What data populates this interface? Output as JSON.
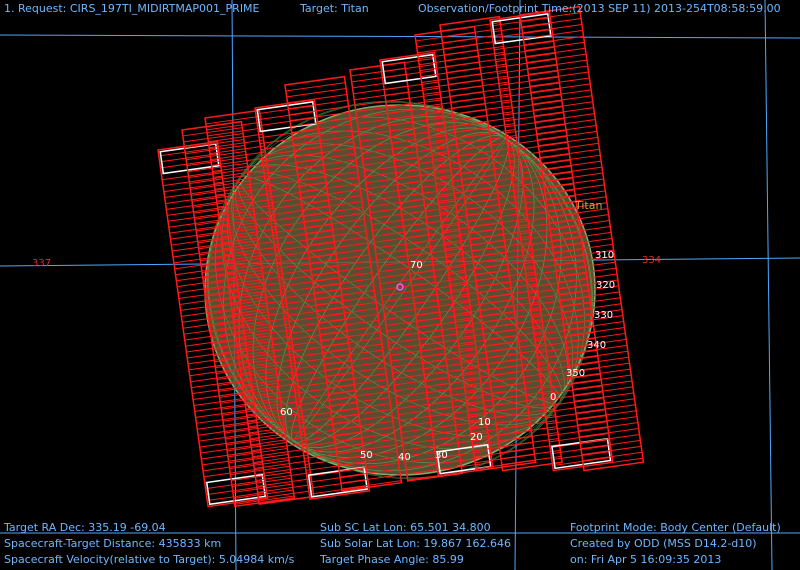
{
  "header": {
    "request": "1. Request: CIRS_197TI_MIDIRTMAP001_PRIME",
    "target": "Target: Titan",
    "time": "Observation/Footprint Time:(2013 SEP 11) 2013-254T08:58:59.00"
  },
  "body_label": "Titan",
  "grid_labels": {
    "left_ra": "337",
    "right_ra": "334",
    "lat_lon": [
      "310",
      "320",
      "330",
      "340",
      "350",
      "0",
      "10",
      "20",
      "30",
      "40",
      "50",
      "60",
      "70"
    ]
  },
  "colors": {
    "footprint": "#ff1a1a",
    "white_outline": "#ffffff",
    "grid": "#6fb7ff",
    "planet": "#7a7a3a",
    "mesh": "#5fbf5f"
  },
  "footer": {
    "left": [
      "Target RA Dec: 335.19  -69.04",
      "Spacecraft-Target Distance:  435833 km",
      "Spacecraft Velocity(relative to Target): 5.04984 km/s"
    ],
    "middle": [
      "Sub SC Lat Lon: 65.501  34.800",
      "Sub Solar Lat Lon: 19.867  162.646",
      "Target Phase Angle: 85.99"
    ],
    "right": [
      "Footprint Mode: Body Center (Default)",
      "Created by ODD (MSS D14.2-d10)",
      "on: Fri Apr  5 16:09:35 2013"
    ]
  }
}
